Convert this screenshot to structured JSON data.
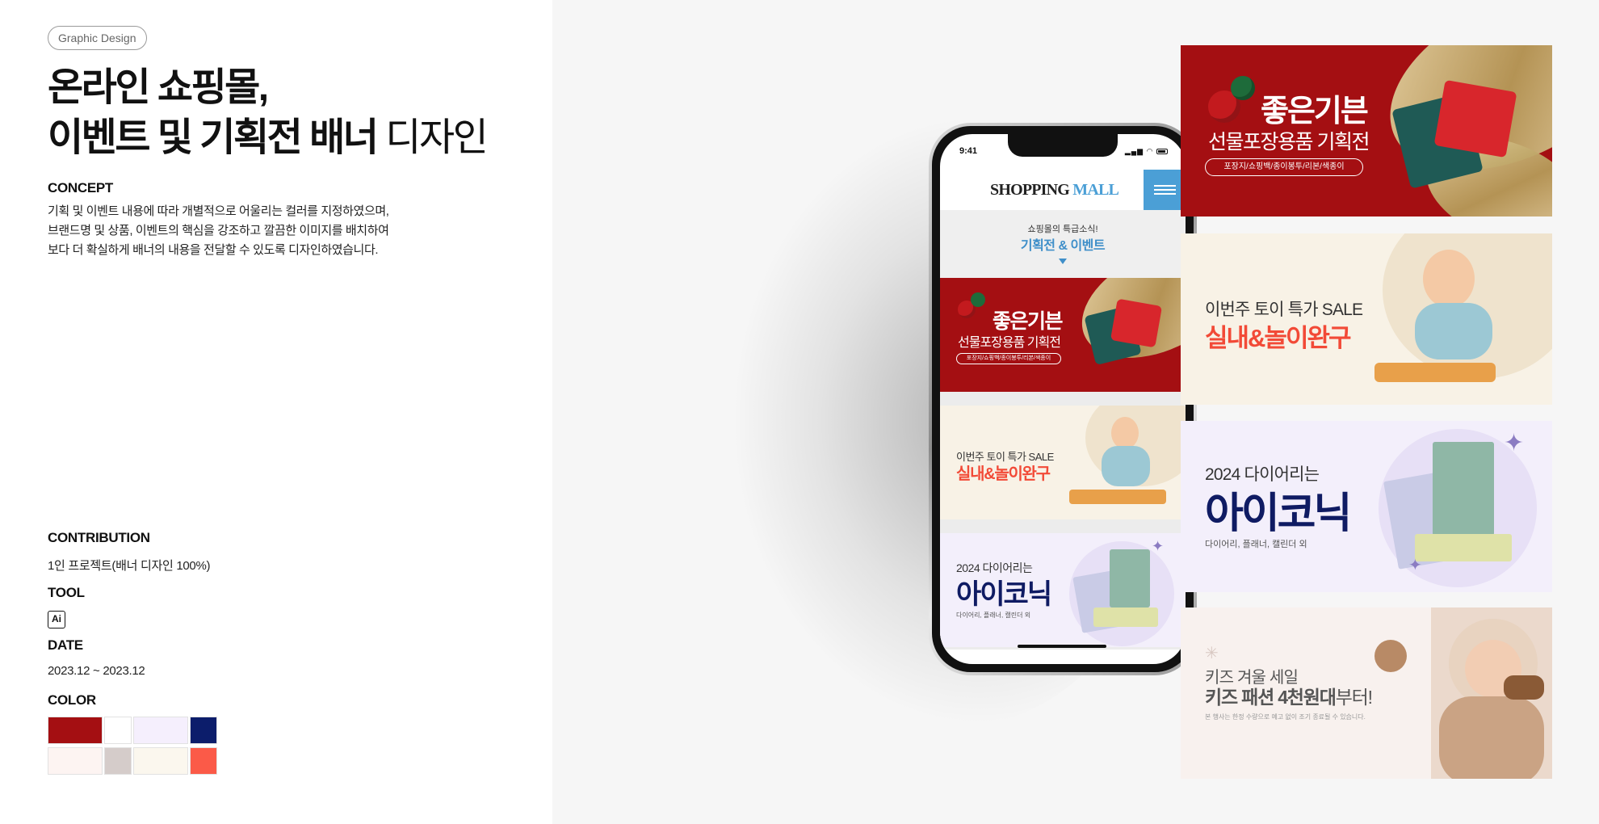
{
  "left_panel": {
    "tag": "Graphic Design",
    "title_line1": "온라인 쇼핑몰,",
    "title_line2_bold": "이벤트 및 기획전 배너 ",
    "title_line2_thin": "디자인",
    "concept": {
      "heading": "CONCEPT",
      "lines": [
        "기획 및 이벤트 내용에 따라 개별적으로 어울리는 컬러를 지정하였으며,",
        "브랜드명 및 상품, 이벤트의 핵심을 강조하고 깔끔한 이미지를 배치하여",
        "보다 더 확실하게 배너의 내용을 전달할 수 있도록 디자인하였습니다."
      ]
    },
    "contribution": {
      "heading": "CONTRIBUTION",
      "value": "1인 프로젝트(배너 디자인 100%)"
    },
    "tool": {
      "heading": "TOOL",
      "value": "Ai"
    },
    "date": {
      "heading": "DATE",
      "value": "2023.12 ~ 2023.12"
    },
    "color": {
      "heading": "COLOR",
      "swatches": [
        "#a40f12",
        "#ffffff",
        "#f5effd",
        "#0c1d6b",
        "#fdf4f2",
        "#d5ccca",
        "#fbf7ee",
        "#fb5a48"
      ]
    }
  },
  "phone": {
    "time": "9:41",
    "logo_main": "SHOPPING ",
    "logo_accent": "MALL",
    "hero_small": "쇼핑몰의 특급소식!",
    "hero_big": "기획전 & 이벤트"
  },
  "banners": {
    "gift": {
      "title": "좋은기븐",
      "subtitle": "선물포장용품 기획전",
      "pill": "포장지/쇼핑백/종이봉투/리본/색종이"
    },
    "toy": {
      "line1": "이번주 토이 특가 SALE",
      "line2": "실내&놀이완구"
    },
    "diary": {
      "line1": "2024 다이어리는",
      "line2": "아이코닉",
      "line3": "다이어리, 플래너, 캘린더 외"
    },
    "winter": {
      "line1": "키즈 겨울 세일",
      "line2_bold": "키즈 패션 4천원대",
      "line2_rest": "부터!",
      "line3": "본 행사는 한정 수량으로 예고 없이 조기 종료될 수 있습니다."
    }
  },
  "colors": {
    "gift_red": "#a40f12",
    "toy_bg": "#f8f2e6",
    "toy_accent": "#f24a37",
    "diary_bg": "#f3effb",
    "diary_navy": "#0f1b63",
    "winter_bg": "#f8f1ee",
    "mall_blue": "#4b9fd6"
  },
  "icons": [
    "menu-icon",
    "signal-icon",
    "wifi-icon",
    "battery-icon",
    "down-arrow-icon",
    "illustrator-icon"
  ]
}
